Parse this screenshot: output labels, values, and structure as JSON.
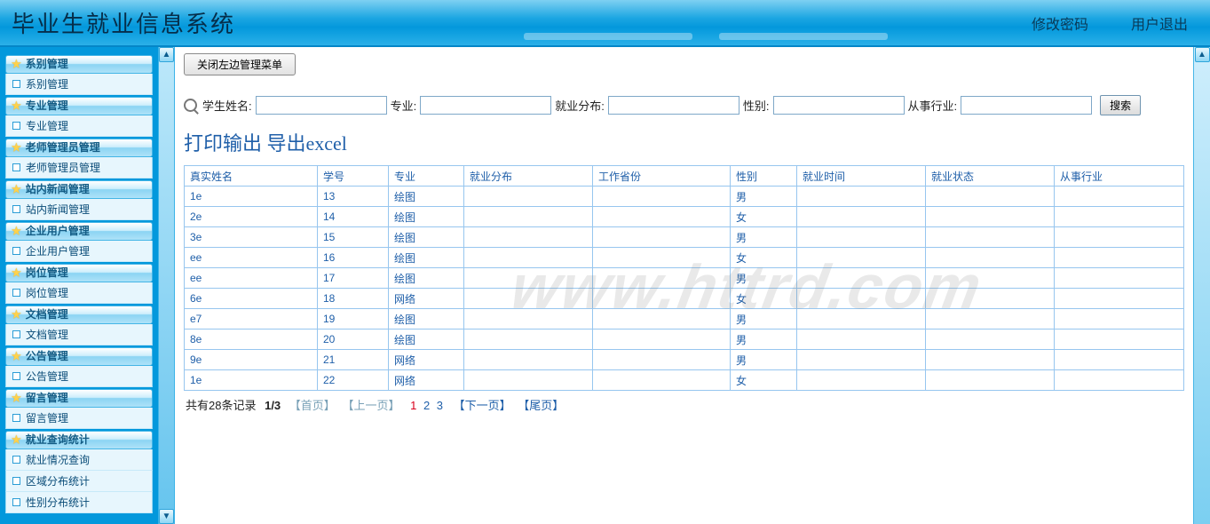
{
  "header": {
    "title": "毕业生就业信息系统",
    "change_password": "修改密码",
    "logout": "用户退出"
  },
  "sidebar": {
    "groups": [
      {
        "header": "系别管理",
        "items": [
          "系别管理"
        ]
      },
      {
        "header": "专业管理",
        "items": [
          "专业管理"
        ]
      },
      {
        "header": "老师管理员管理",
        "items": [
          "老师管理员管理"
        ]
      },
      {
        "header": "站内新闻管理",
        "items": [
          "站内新闻管理"
        ]
      },
      {
        "header": "企业用户管理",
        "items": [
          "企业用户管理"
        ]
      },
      {
        "header": "岗位管理",
        "items": [
          "岗位管理"
        ]
      },
      {
        "header": "文档管理",
        "items": [
          "文档管理"
        ]
      },
      {
        "header": "公告管理",
        "items": [
          "公告管理"
        ]
      },
      {
        "header": "留言管理",
        "items": [
          "留言管理"
        ]
      },
      {
        "header": "就业查询统计",
        "items": [
          "就业情况查询",
          "区域分布统计",
          "性别分布统计"
        ]
      }
    ]
  },
  "toolbar": {
    "close_menu_btn": "关闭左边管理菜单"
  },
  "search": {
    "labels": {
      "name": "学生姓名:",
      "major": "专业:",
      "dist": "就业分布:",
      "gender": "性别:",
      "industry": "从事行业:"
    },
    "button": "搜索"
  },
  "actions": {
    "print": "打印输出",
    "export": "导出excel"
  },
  "table": {
    "headers": [
      "真实姓名",
      "学号",
      "专业",
      "就业分布",
      "工作省份",
      "性别",
      "就业时间",
      "就业状态",
      "从事行业"
    ],
    "rows": [
      {
        "name": "1e",
        "id": "13",
        "major": "绘图",
        "dist": "",
        "province": "",
        "gender": "男",
        "time": "",
        "status": "",
        "industry": ""
      },
      {
        "name": "2e",
        "id": "14",
        "major": "绘图",
        "dist": "",
        "province": "",
        "gender": "女",
        "time": "",
        "status": "",
        "industry": ""
      },
      {
        "name": "3e",
        "id": "15",
        "major": "绘图",
        "dist": "",
        "province": "",
        "gender": "男",
        "time": "",
        "status": "",
        "industry": ""
      },
      {
        "name": "ee",
        "id": "16",
        "major": "绘图",
        "dist": "",
        "province": "",
        "gender": "女",
        "time": "",
        "status": "",
        "industry": ""
      },
      {
        "name": "ee",
        "id": "17",
        "major": "绘图",
        "dist": "",
        "province": "",
        "gender": "男",
        "time": "",
        "status": "",
        "industry": ""
      },
      {
        "name": "6e",
        "id": "18",
        "major": "网络",
        "dist": "",
        "province": "",
        "gender": "女",
        "time": "",
        "status": "",
        "industry": ""
      },
      {
        "name": "e7",
        "id": "19",
        "major": "绘图",
        "dist": "",
        "province": "",
        "gender": "男",
        "time": "",
        "status": "",
        "industry": ""
      },
      {
        "name": "8e",
        "id": "20",
        "major": "绘图",
        "dist": "",
        "province": "",
        "gender": "男",
        "time": "",
        "status": "",
        "industry": ""
      },
      {
        "name": "9e",
        "id": "21",
        "major": "网络",
        "dist": "",
        "province": "",
        "gender": "男",
        "time": "",
        "status": "",
        "industry": ""
      },
      {
        "name": "1e",
        "id": "22",
        "major": "网络",
        "dist": "",
        "province": "",
        "gender": "女",
        "time": "",
        "status": "",
        "industry": ""
      }
    ]
  },
  "pagination": {
    "total_text": "共有28条记录",
    "page_indicator": "1/3",
    "first": "【首页】",
    "prev": "【上一页】",
    "next": "【下一页】",
    "last": "【尾页】",
    "pages": [
      "1",
      "2",
      "3"
    ]
  },
  "watermark": "www.httrd.com",
  "scroll": {
    "up": "▲",
    "down": "▼"
  }
}
